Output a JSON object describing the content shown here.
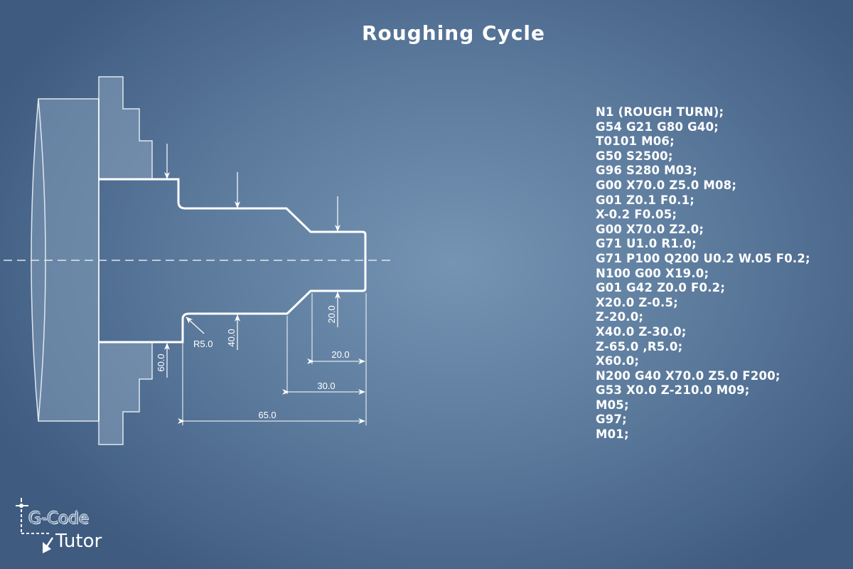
{
  "title": "Roughing Cycle",
  "program_lines": [
    "N1 (ROUGH TURN);",
    "G54 G21 G80 G40;",
    "T0101 M06;",
    "G50 S2500;",
    "G96 S280 M03;",
    "G00 X70.0 Z5.0 M08;",
    "G01 Z0.1 F0.1;",
    "X-0.2 F0.05;",
    "G00 X70.0 Z2.0;",
    "G71 U1.0 R1.0;",
    "G71 P100 Q200 U0.2 W.05 F0.2;",
    "N100 G00 X19.0;",
    "G01 G42 Z0.0 F0.2;",
    "X20.0 Z-0.5;",
    "Z-20.0;",
    "X40.0 Z-30.0;",
    "Z-65.0 ,R5.0;",
    "X60.0;",
    "N200 G40 X70.0 Z5.0 F200;",
    "G53 X0.0 Z-210.0 M09;",
    "M05;",
    "G97;",
    "M01;"
  ],
  "dimensions": {
    "dia_60": "60.0",
    "dia_40": "40.0",
    "dia_20": "20.0",
    "radius": "R5.0",
    "len_20": "20.0",
    "len_30": "30.0",
    "len_65": "65.0"
  },
  "logo": {
    "line1": "G-Code",
    "line2": "Tutor"
  },
  "colors": {
    "line": "#ffffff",
    "chuck_fill": "#8aa3bd"
  }
}
